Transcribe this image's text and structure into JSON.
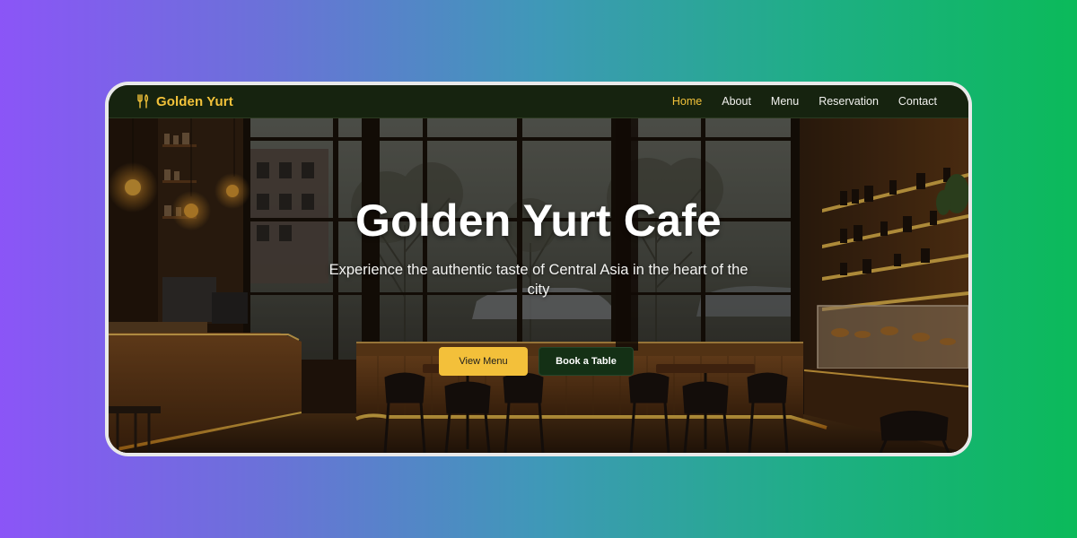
{
  "brand": {
    "name": "Golden Yurt",
    "icon": "fork-knife-icon",
    "color": "#f2c23a"
  },
  "nav": {
    "items": [
      {
        "label": "Home",
        "active": true
      },
      {
        "label": "About",
        "active": false
      },
      {
        "label": "Menu",
        "active": false
      },
      {
        "label": "Reservation",
        "active": false
      },
      {
        "label": "Contact",
        "active": false
      }
    ]
  },
  "hero": {
    "title": "Golden Yurt Cafe",
    "subtitle": "Experience the authentic taste of Central Asia in the heart of the city",
    "primary_button": "View Menu",
    "secondary_button": "Book a Table",
    "background": "cafe-interior-photo"
  },
  "colors": {
    "accent": "#f3c03a",
    "nav_background": "#16230f",
    "secondary_button": "#143015"
  }
}
